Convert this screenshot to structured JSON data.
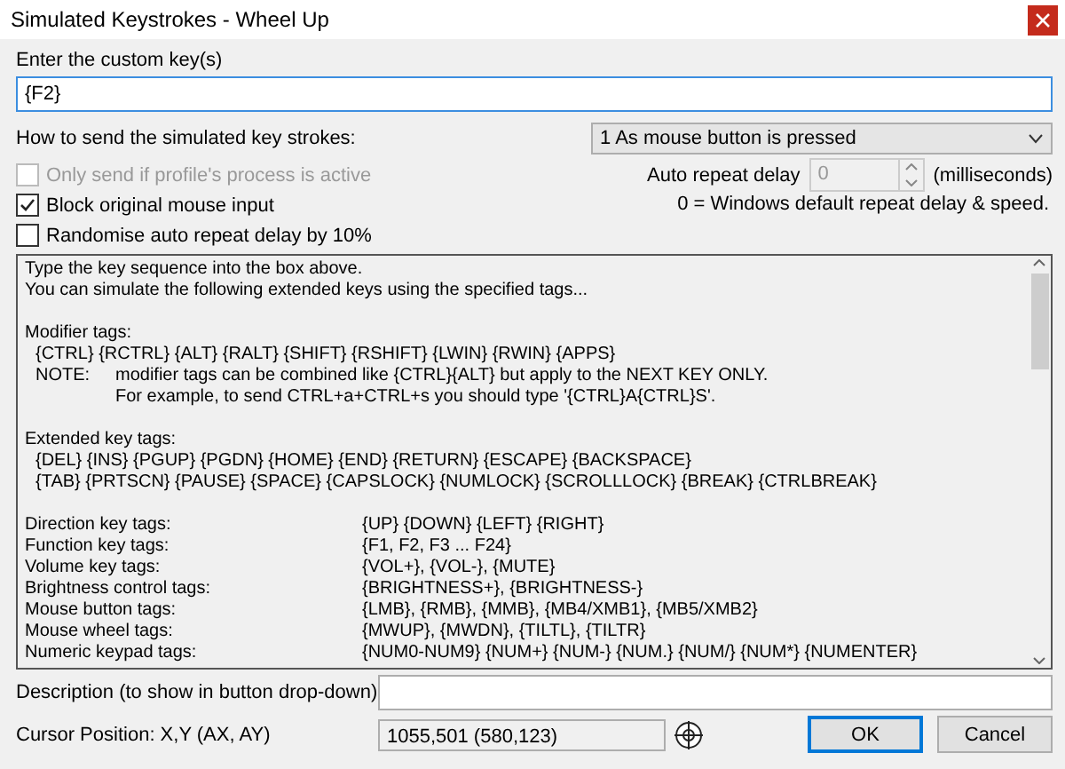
{
  "window": {
    "title": "Simulated Keystrokes - Wheel Up"
  },
  "custom_key": {
    "label": "Enter the custom key(s)",
    "value": "{F2}"
  },
  "send_mode": {
    "label": "How to send the simulated key strokes:",
    "value": "1 As mouse button is pressed"
  },
  "options": [
    {
      "label": "Only send if profile's process is active",
      "checked": false,
      "disabled": true
    },
    {
      "label": "Block original mouse input",
      "checked": true,
      "disabled": false
    },
    {
      "label": "Randomise auto repeat delay by 10%",
      "checked": false,
      "disabled": false
    }
  ],
  "repeat": {
    "label": "Auto repeat delay",
    "value": "0",
    "unit": "(milliseconds)",
    "note": "0 = Windows default repeat delay & speed.",
    "disabled": true
  },
  "help": {
    "intro": [
      "Type the key sequence into the box above.",
      "You can simulate the following extended keys using the specified tags..."
    ],
    "sections": [
      {
        "title": "Modifier tags:",
        "lines": [
          "{CTRL} {RCTRL} {ALT} {RALT} {SHIFT} {RSHIFT} {LWIN} {RWIN} {APPS}"
        ],
        "note": {
          "label": "NOTE:",
          "lines": [
            "modifier tags can be combined like {CTRL}{ALT} but apply to the NEXT KEY ONLY.",
            "For example, to send CTRL+a+CTRL+s you should type '{CTRL}A{CTRL}S'."
          ]
        }
      },
      {
        "title": "Extended key tags:",
        "lines": [
          "{DEL} {INS} {PGUP} {PGDN} {HOME} {END} {RETURN} {ESCAPE} {BACKSPACE}",
          "{TAB} {PRTSCN} {PAUSE} {SPACE} {CAPSLOCK} {NUMLOCK} {SCROLLLOCK} {BREAK} {CTRLBREAK}"
        ]
      }
    ],
    "tag_rows": [
      {
        "label": "Direction key tags:",
        "value": "{UP} {DOWN} {LEFT} {RIGHT}"
      },
      {
        "label": "Function key tags:",
        "value": "{F1, F2, F3 ... F24}"
      },
      {
        "label": "Volume key tags:",
        "value": "{VOL+}, {VOL-}, {MUTE}"
      },
      {
        "label": "Brightness control tags:",
        "value": "{BRIGHTNESS+}, {BRIGHTNESS-}"
      },
      {
        "label": "Mouse button tags:",
        "value": "{LMB}, {RMB}, {MMB}, {MB4/XMB1}, {MB5/XMB2}"
      },
      {
        "label": "Mouse wheel tags:",
        "value": "{MWUP}, {MWDN}, {TILTL}, {TILTR}"
      },
      {
        "label": "Numeric keypad tags:",
        "value": "{NUM0-NUM9} {NUM+} {NUM-} {NUM.} {NUM/} {NUM*} {NUMENTER}"
      }
    ]
  },
  "description": {
    "label": "Description (to show in button drop-down)"
  },
  "cursor": {
    "label": "Cursor Position: X,Y (AX, AY)",
    "value": "1055,501 (580,123)"
  },
  "buttons": [
    {
      "label": "OK",
      "default": true
    },
    {
      "label": "Cancel",
      "default": false
    }
  ]
}
